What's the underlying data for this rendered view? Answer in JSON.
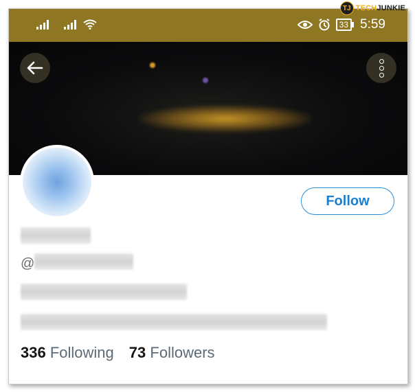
{
  "watermark": {
    "logo_letter": "TJ",
    "brand_a": "TECH",
    "brand_b": "JUNKIE"
  },
  "status_bar": {
    "time": "5:59",
    "battery": "33",
    "icons": [
      "signal-icon",
      "signal-icon",
      "wifi-icon",
      "eye-icon",
      "alarm-icon",
      "battery-icon"
    ]
  },
  "header": {
    "back_icon": "arrow-left-icon",
    "more_icon": "more-vertical-icon"
  },
  "profile": {
    "follow_label": "Follow",
    "handle_prefix": "@",
    "following_count": "336",
    "following_label": "Following",
    "followers_count": "73",
    "followers_label": "Followers"
  },
  "colors": {
    "status_bar": "#8f7623",
    "accent": "#1b7fd1",
    "banner": "#0b0b0d"
  }
}
